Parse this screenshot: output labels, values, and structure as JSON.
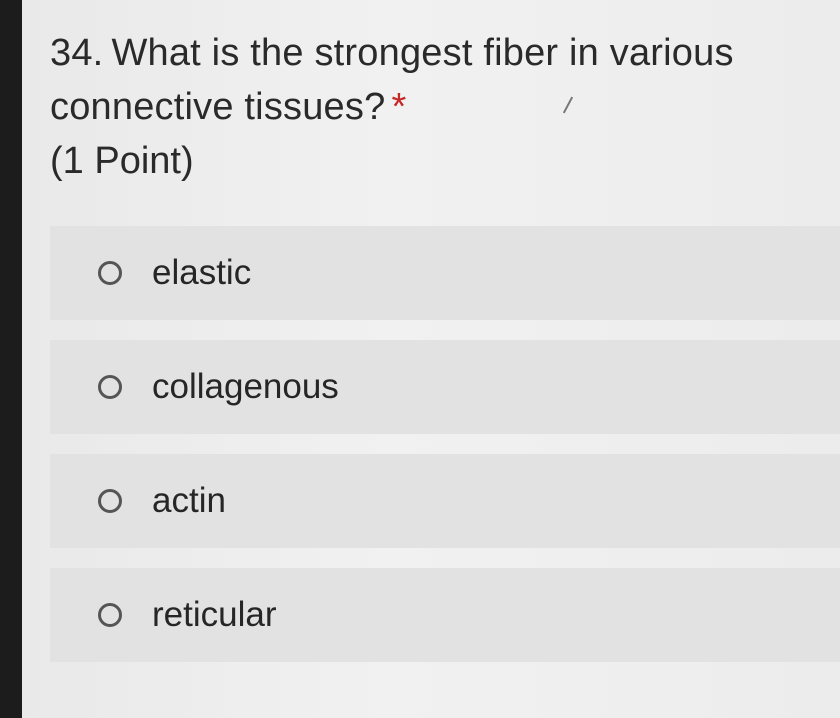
{
  "question": {
    "number": "34.",
    "text": "What is the strongest fiber in various connective tissues?",
    "required_marker": "*",
    "points": "(1 Point)"
  },
  "options": [
    {
      "label": "elastic",
      "selected": false
    },
    {
      "label": "collagenous",
      "selected": false
    },
    {
      "label": "actin",
      "selected": false
    },
    {
      "label": "reticular",
      "selected": false
    }
  ],
  "colors": {
    "required": "#c62828",
    "text": "#2a2a2a",
    "option_bg": "#e2e2e2"
  }
}
